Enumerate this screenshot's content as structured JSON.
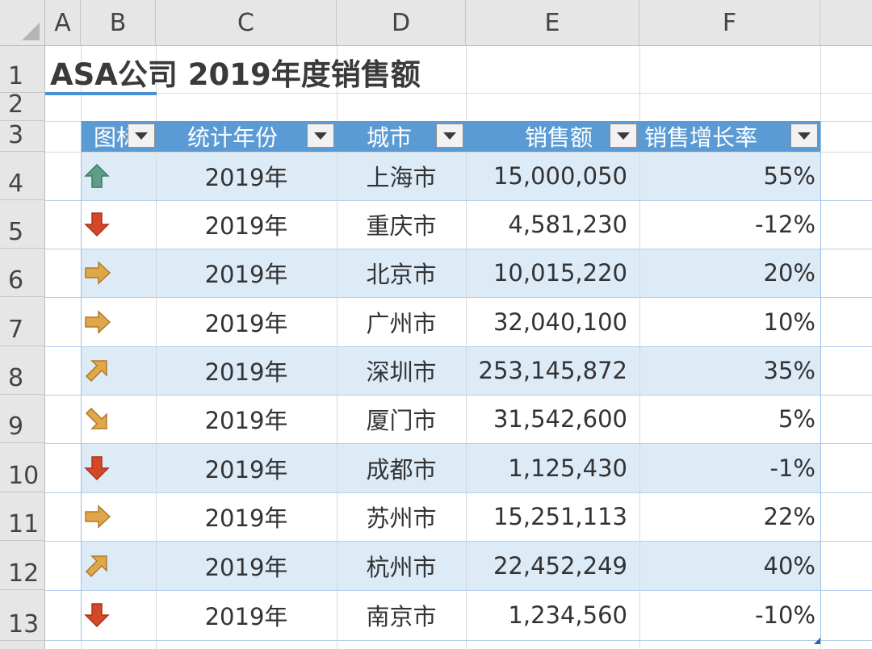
{
  "columns": [
    "A",
    "B",
    "C",
    "D",
    "E",
    "F"
  ],
  "rows": [
    "1",
    "2",
    "3",
    "4",
    "5",
    "6",
    "7",
    "8",
    "9",
    "10",
    "11",
    "12",
    "13"
  ],
  "title": "ASA公司 2019年度销售额",
  "table": {
    "headers": [
      "图标",
      "统计年份",
      "城市",
      "销售额",
      "销售增长率"
    ],
    "records": [
      {
        "icon": "arrow-up-icon",
        "year": "2019年",
        "city": "上海市",
        "sales": "15,000,050",
        "growth": "55%"
      },
      {
        "icon": "arrow-down-icon",
        "year": "2019年",
        "city": "重庆市",
        "sales": "4,581,230",
        "growth": "-12%"
      },
      {
        "icon": "arrow-right-icon",
        "year": "2019年",
        "city": "北京市",
        "sales": "10,015,220",
        "growth": "20%"
      },
      {
        "icon": "arrow-right-icon",
        "year": "2019年",
        "city": "广州市",
        "sales": "32,040,100",
        "growth": "10%"
      },
      {
        "icon": "arrow-up-right-icon",
        "year": "2019年",
        "city": "深圳市",
        "sales": "253,145,872",
        "growth": "35%"
      },
      {
        "icon": "arrow-down-right-icon",
        "year": "2019年",
        "city": "厦门市",
        "sales": "31,542,600",
        "growth": "5%"
      },
      {
        "icon": "arrow-down-icon",
        "year": "2019年",
        "city": "成都市",
        "sales": "1,125,430",
        "growth": "-1%"
      },
      {
        "icon": "arrow-right-icon",
        "year": "2019年",
        "city": "苏州市",
        "sales": "15,251,113",
        "growth": "22%"
      },
      {
        "icon": "arrow-up-right-icon",
        "year": "2019年",
        "city": "杭州市",
        "sales": "22,452,249",
        "growth": "40%"
      },
      {
        "icon": "arrow-down-icon",
        "year": "2019年",
        "city": "南京市",
        "sales": "1,234,560",
        "growth": "-10%"
      }
    ]
  },
  "colors": {
    "header_fill": "#5b9bd5",
    "band_fill": "#ddebf7",
    "icon_green": "#5e9e86",
    "icon_red": "#d4482a",
    "icon_gold": "#e0a64a"
  }
}
